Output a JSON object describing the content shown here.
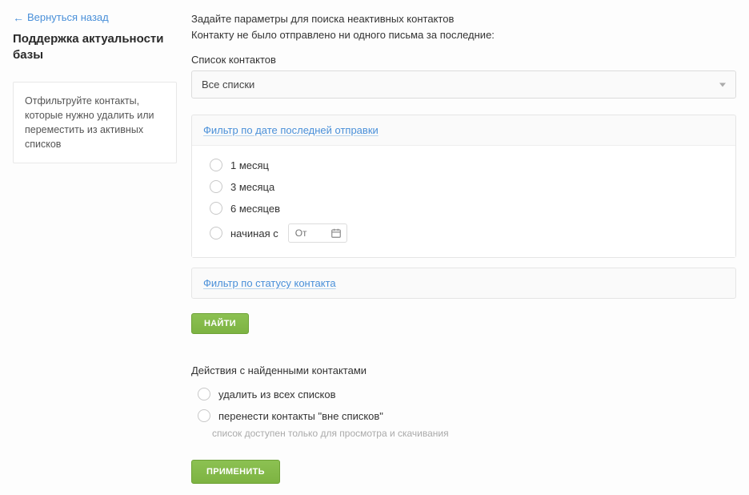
{
  "back_label": "Вернуться назад",
  "page_title": "Поддержка актуальности базы",
  "info_box": "Отфильтруйте контакты, которые нужно удалить или переместить из активных списков",
  "main": {
    "intro_line": "Задайте параметры для поиска неактивных контактов",
    "intro_sub": "Контакту не было отправлено ни одного письма за последние:",
    "list_label": "Список контактов",
    "list_selected": "Все списки",
    "filter_date_title": "Фильтр по дате последней отправки",
    "period_options": [
      "1 месяц",
      "3 месяца",
      "6 месяцев"
    ],
    "starting_from_label": "начиная с",
    "date_placeholder": "От",
    "filter_status_title": "Фильтр по статусу контакта",
    "find_button": "НАЙТИ",
    "actions_title": "Действия с найденными контактами",
    "action_options": [
      "удалить из всех списков",
      "перенести контакты \"вне списков\""
    ],
    "action_hint": "список доступен только для просмотра и скачивания",
    "apply_button": "ПРИМЕНИТЬ"
  }
}
